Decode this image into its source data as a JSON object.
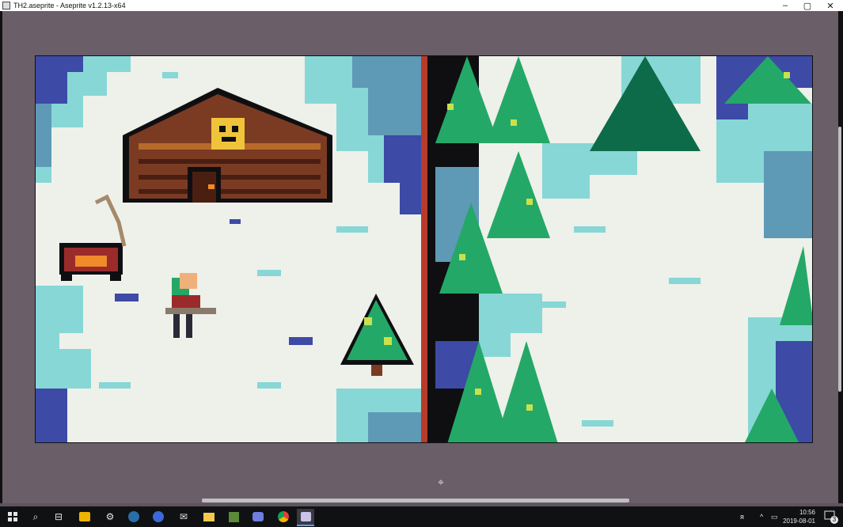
{
  "window": {
    "title": "TH2.aseprite - Aseprite v1.2.13-x64",
    "controls": {
      "minimize": "–",
      "maximize": "▢",
      "close": "✕"
    }
  },
  "canvas": {
    "palette": {
      "snow": "#eef0ea",
      "ice": "#87d7d6",
      "shadow": "#5e99b6",
      "deep": "#3d4aa6",
      "outline": "#0f0f12",
      "tree": "#24a867",
      "tree_dark": "#0d6b4a",
      "tree_light": "#c8e24b",
      "cabin": "#7b3b23",
      "cabin_light": "#b86a2c",
      "gold": "#f0c43a",
      "red": "#9b2b2b",
      "divider": "#b73a2a"
    }
  },
  "taskbar": {
    "icons": [
      "windows-start-icon",
      "search-icon",
      "task-view-icon",
      "store-icon",
      "settings-icon",
      "steam-icon",
      "browser-icon",
      "mail-icon",
      "file-explorer-icon",
      "minecraft-icon",
      "discord-icon",
      "chrome-icon",
      "aseprite-icon"
    ],
    "time": "10:56",
    "date": "2019-08-01",
    "notification_count": "3"
  }
}
